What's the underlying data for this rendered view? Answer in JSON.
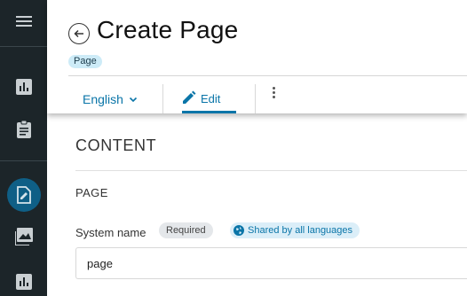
{
  "sidebar": {
    "items": [
      {
        "icon": "menu-icon"
      },
      {
        "icon": "bar-chart-icon"
      },
      {
        "icon": "clipboard-icon"
      },
      {
        "icon": "page-edit-icon",
        "active": true
      },
      {
        "icon": "image-icon"
      },
      {
        "icon": "bar-chart-icon"
      }
    ],
    "colors": {
      "background": "#1c2529",
      "active": "#0f5f86"
    }
  },
  "header": {
    "title": "Create Page",
    "badge": "Page",
    "language": "English",
    "edit_label": "Edit"
  },
  "content": {
    "section_title": "CONTENT",
    "sub_title": "PAGE",
    "field": {
      "label": "System name",
      "required_label": "Required",
      "shared_label": "Shared by all languages",
      "value": "page"
    }
  },
  "colors": {
    "accent": "#0a75a8",
    "badge_bg": "#cdebf7"
  }
}
